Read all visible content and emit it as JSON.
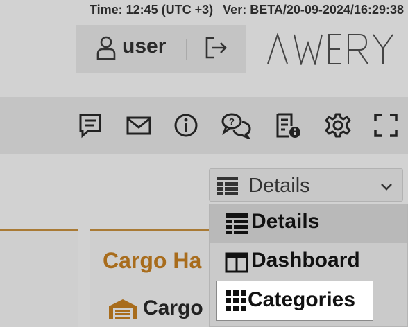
{
  "header": {
    "time_text": "Time: 12:45 (UTC +3)",
    "version_text": "Ver: BETA/20-09-2024/16:29:38"
  },
  "user": {
    "name": "user",
    "user_icon": "person-icon",
    "logout_icon": "logout-icon"
  },
  "brand": {
    "logo_text": "AWERY"
  },
  "toolbar": {
    "icons": [
      "feedback-icon",
      "mail-icon",
      "info-icon",
      "chat-icon",
      "document-info-icon",
      "gear-icon",
      "fullscreen-icon"
    ]
  },
  "view_select": {
    "selected_label": "Details",
    "icon": "details-grid-icon",
    "chevron_icon": "chevron-down-icon"
  },
  "view_options": [
    {
      "label": "Details",
      "icon": "details-grid-icon",
      "active": true
    },
    {
      "label": "Dashboard",
      "icon": "dashboard-icon",
      "active": false
    },
    {
      "label": "Categories",
      "icon": "categories-grid-icon",
      "focused": true
    }
  ],
  "cards": {
    "middle_title": "Cargo Ha",
    "middle_sub": "Cargo",
    "middle_sub_icon": "warehouse-icon"
  },
  "colors": {
    "background": "#d2d2d2",
    "panel": "#c4c4c4",
    "accent": "#a86c1c",
    "active_item": "#b9b9b9",
    "focused_item": "#ffffff"
  }
}
